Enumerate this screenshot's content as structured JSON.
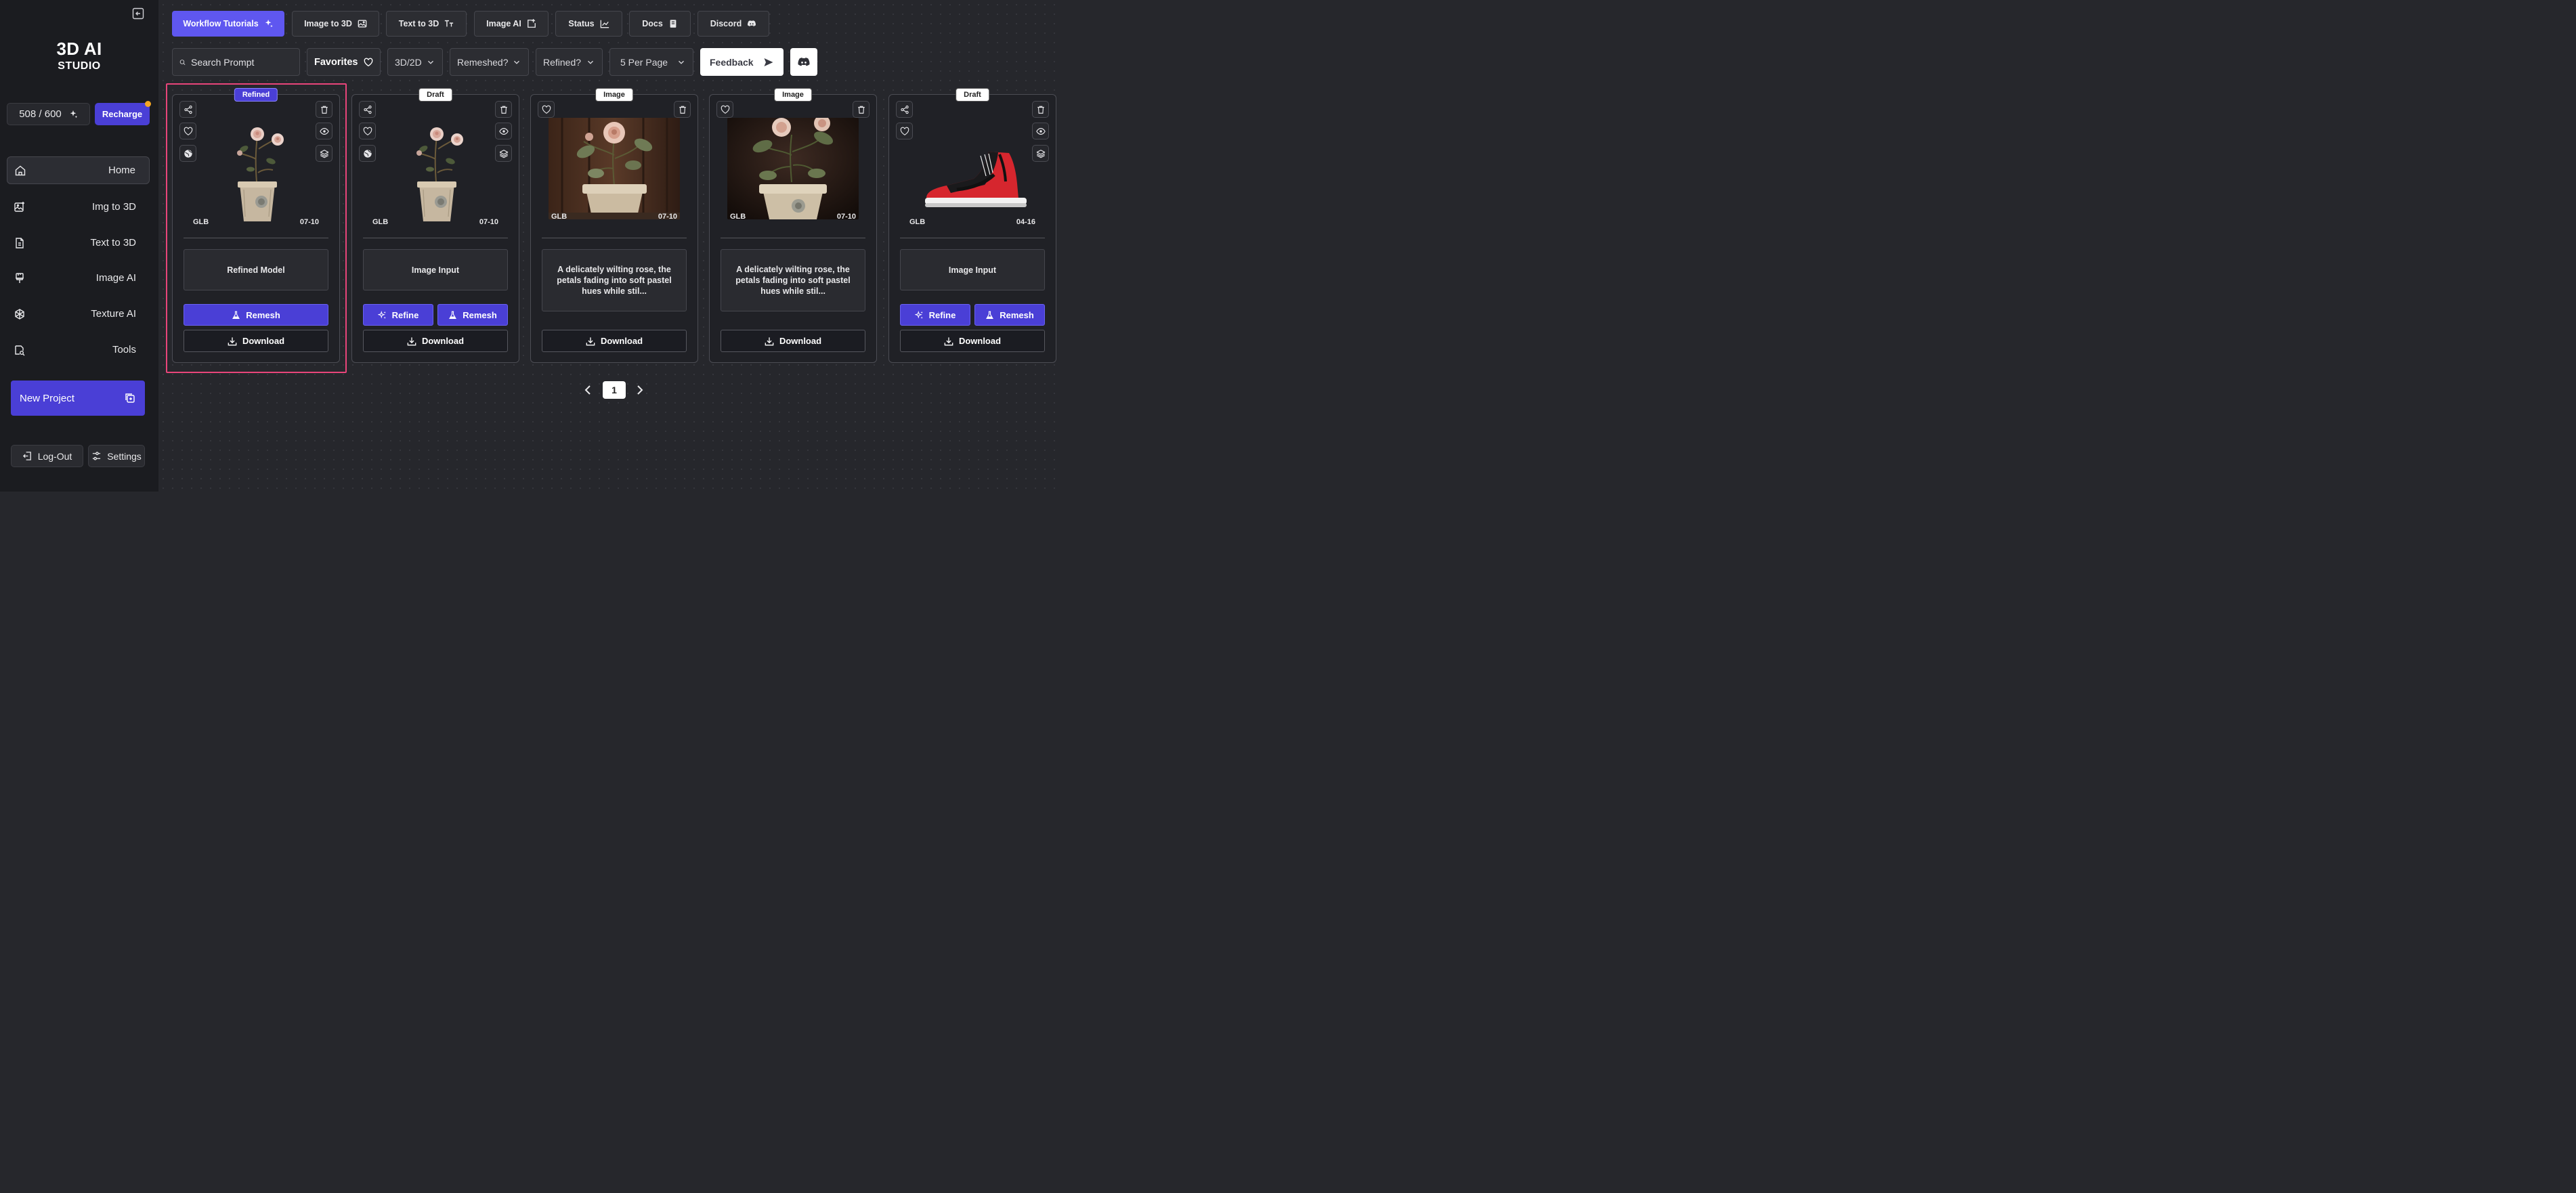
{
  "brand": {
    "line1": "3D AI",
    "line2": "STUDIO"
  },
  "credits": {
    "value": "508 / 600",
    "recharge_label": "Recharge"
  },
  "sidebar": {
    "items": [
      {
        "label": "Home",
        "icon": "home-icon"
      },
      {
        "label": "Img to 3D",
        "icon": "image-plus-icon"
      },
      {
        "label": "Text to 3D",
        "icon": "file-text-icon"
      },
      {
        "label": "Image AI",
        "icon": "brush-icon"
      },
      {
        "label": "Texture AI",
        "icon": "texture-icon"
      },
      {
        "label": "Tools",
        "icon": "search-folder-icon"
      }
    ],
    "new_project": "New Project",
    "logout": "Log-Out",
    "settings": "Settings"
  },
  "topnav": [
    {
      "label": "Workflow Tutorials",
      "icon": "sparkles-icon"
    },
    {
      "label": "Image to 3D",
      "icon": "image-icon"
    },
    {
      "label": "Text to 3D",
      "icon": "text-size-icon"
    },
    {
      "label": "Image AI",
      "icon": "image-export-icon"
    },
    {
      "label": "Status",
      "icon": "chart-icon"
    },
    {
      "label": "Docs",
      "icon": "book-icon"
    },
    {
      "label": "Discord",
      "icon": "discord-icon"
    }
  ],
  "filters": {
    "search_placeholder": "Search Prompt",
    "favorites": "Favorites",
    "type": "3D/2D",
    "remeshed": "Remeshed?",
    "refined": "Refined?",
    "per_page": "5 Per Page",
    "feedback": "Feedback"
  },
  "cards": [
    {
      "badge": "Refined",
      "format": "GLB",
      "date": "07-10",
      "info": "Refined Model",
      "remesh": "Remesh",
      "download": "Download"
    },
    {
      "badge": "Draft",
      "format": "GLB",
      "date": "07-10",
      "info": "Image Input",
      "refine": "Refine",
      "remesh": "Remesh",
      "download": "Download"
    },
    {
      "badge": "Image",
      "format": "GLB",
      "date": "07-10",
      "info": "A delicately wilting rose, the petals fading into soft pastel hues while stil...",
      "download": "Download"
    },
    {
      "badge": "Image",
      "format": "GLB",
      "date": "07-10",
      "info": "A delicately wilting rose, the petals fading into soft pastel hues while stil...",
      "download": "Download"
    },
    {
      "badge": "Draft",
      "format": "GLB",
      "date": "04-16",
      "info": "Image Input",
      "refine": "Refine",
      "remesh": "Remesh",
      "download": "Download"
    }
  ],
  "pagination": {
    "current": "1"
  },
  "colors": {
    "accent": "#4a3fd6",
    "accent_light": "#5f57f0",
    "selection": "#e8457a",
    "notification": "#f5a623"
  }
}
